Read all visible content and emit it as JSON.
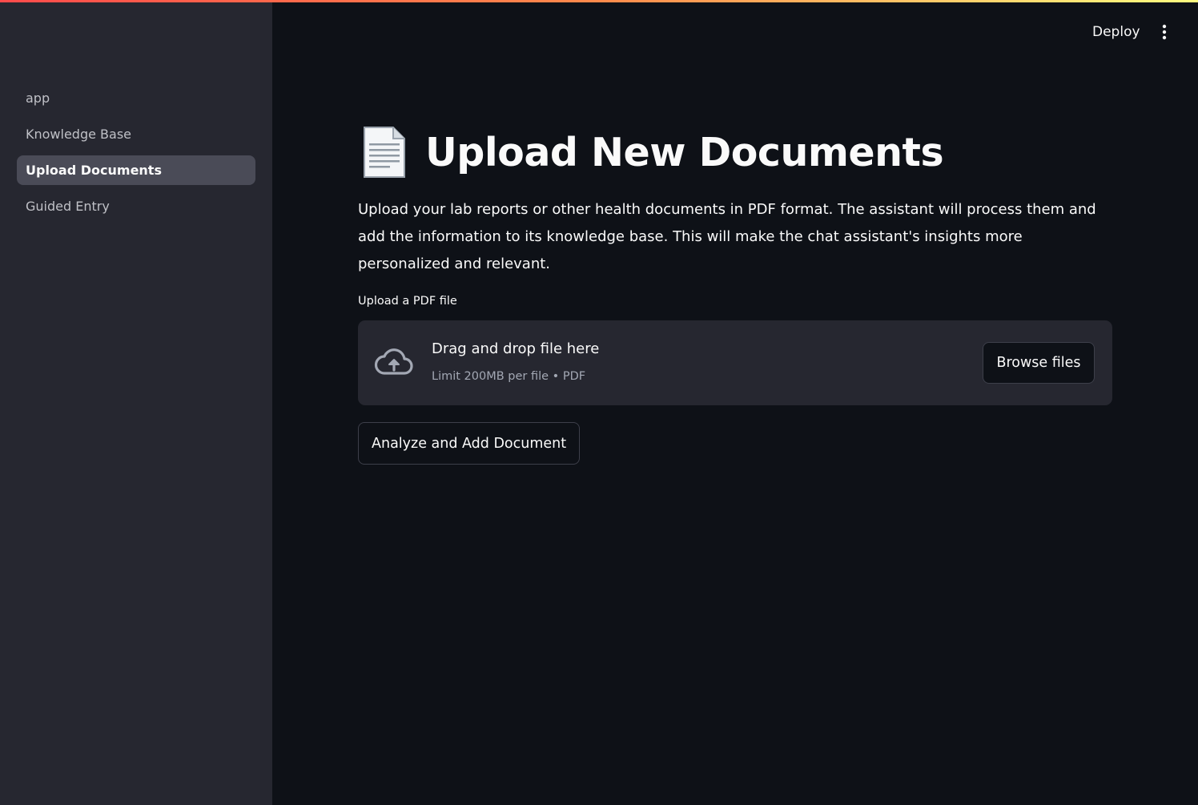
{
  "sidebar": {
    "items": [
      {
        "label": "app",
        "active": false
      },
      {
        "label": "Knowledge Base",
        "active": false
      },
      {
        "label": "Upload Documents",
        "active": true
      },
      {
        "label": "Guided Entry",
        "active": false
      }
    ]
  },
  "header": {
    "deploy_label": "Deploy",
    "menu_icon": "vertical-ellipsis-icon"
  },
  "main": {
    "title_icon": "page-document-icon",
    "title": "Upload New Documents",
    "description": "Upload your lab reports or other health documents in PDF format. The assistant will process them and add the information to its knowledge base. This will make the chat assistant's insights more personalized and relevant.",
    "uploader": {
      "label": "Upload a PDF file",
      "icon": "cloud-upload-icon",
      "dropzone_title": "Drag and drop file here",
      "dropzone_subtitle": "Limit 200MB per file • PDF",
      "browse_label": "Browse files"
    },
    "analyze_label": "Analyze and Add Document"
  },
  "colors": {
    "background": "#0e1117",
    "sidebar": "#262730",
    "sidebar_active": "#4a4b57",
    "accent_gradient_start": "#ff4b4b",
    "accent_gradient_end": "#fffd80"
  }
}
